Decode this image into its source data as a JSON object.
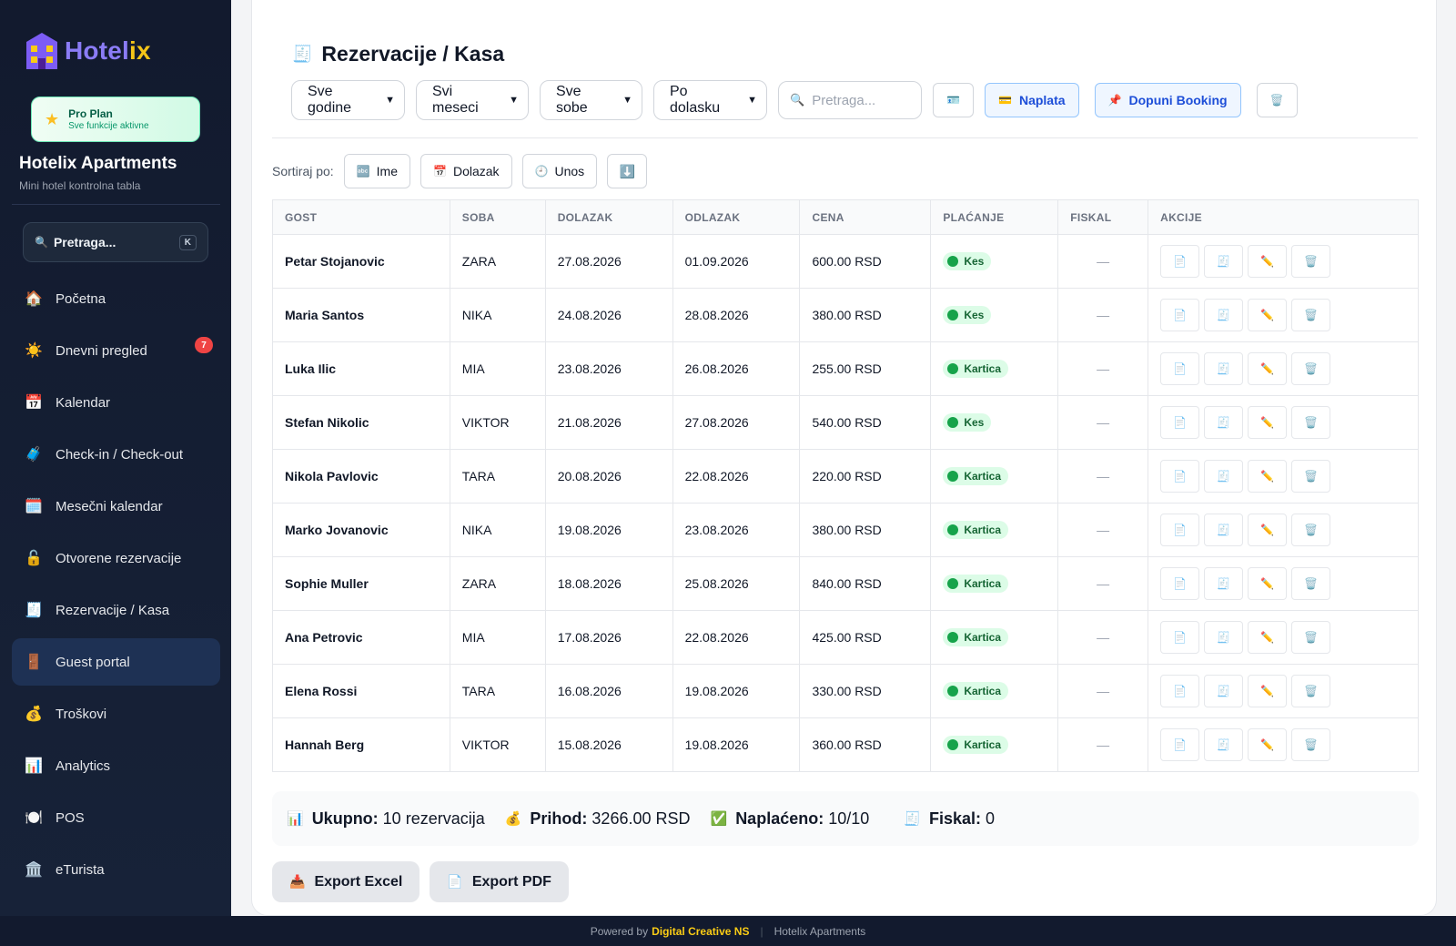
{
  "sidebar": {
    "logo": {
      "text_a": "Hotel",
      "text_b": "ix"
    },
    "plan": {
      "title": "Pro Plan",
      "subtitle": "Sve funkcije aktivne"
    },
    "hotel_name": "Hotelix Apartments",
    "hotel_sub": "Mini hotel kontrolna tabla",
    "search": {
      "label": "Pretraga...",
      "shortcut": "K"
    },
    "items": [
      {
        "label": "Početna",
        "icon": "house-icon",
        "glyph": "🏠"
      },
      {
        "label": "Dnevni pregled",
        "icon": "sun-icon",
        "glyph": "☀️",
        "badge": "7"
      },
      {
        "label": "Kalendar",
        "icon": "calendar-icon",
        "glyph": "📅"
      },
      {
        "label": "Check-in / Check-out",
        "icon": "luggage-icon",
        "glyph": "🧳"
      },
      {
        "label": "Mesečni kalendar",
        "icon": "calendar-month-icon",
        "glyph": "🗓️"
      },
      {
        "label": "Otvorene rezervacije",
        "icon": "lock-icon",
        "glyph": "🔓"
      },
      {
        "label": "Rezervacije / Kasa",
        "icon": "receipt-icon",
        "glyph": "🧾"
      },
      {
        "label": "Guest portal",
        "icon": "door-icon",
        "glyph": "🚪",
        "active": true
      },
      {
        "label": "Troškovi",
        "icon": "money-bag-icon",
        "glyph": "💰"
      },
      {
        "label": "Analytics",
        "icon": "bar-chart-icon",
        "glyph": "📊"
      },
      {
        "label": "POS",
        "icon": "plate-icon",
        "glyph": "🍽️"
      },
      {
        "label": "eTurista",
        "icon": "building-icon",
        "glyph": "🏛️"
      }
    ]
  },
  "main": {
    "title": "Rezervacije / Kasa",
    "title_icon": "🧾",
    "filters": {
      "year": "Sve godine",
      "month": "Svi meseci",
      "room": "Sve sobe",
      "order": "Po dolasku",
      "search_placeholder": "Pretraga..."
    },
    "buttons": {
      "naplata": "Naplata",
      "dopuni": "Dopuni Booking"
    },
    "sort": {
      "label": "Sortiraj po:",
      "name": "Ime",
      "arrival": "Dolazak",
      "entry": "Unos"
    },
    "columns": [
      "GOST",
      "SOBA",
      "DOLAZAK",
      "ODLAZAK",
      "CENA",
      "PLAĆANJE",
      "FISKAL",
      "AKCIJE"
    ],
    "rows": [
      {
        "guest": "Petar Stojanovic",
        "room": "ZARA",
        "arrival": "27.08.2026",
        "departure": "01.09.2026",
        "price": "600.00 RSD",
        "payment": "Kes",
        "fiscal": "—"
      },
      {
        "guest": "Maria Santos",
        "room": "NIKA",
        "arrival": "24.08.2026",
        "departure": "28.08.2026",
        "price": "380.00 RSD",
        "payment": "Kes",
        "fiscal": "—"
      },
      {
        "guest": "Luka Ilic",
        "room": "MIA",
        "arrival": "23.08.2026",
        "departure": "26.08.2026",
        "price": "255.00 RSD",
        "payment": "Kartica",
        "fiscal": "—"
      },
      {
        "guest": "Stefan Nikolic",
        "room": "VIKTOR",
        "arrival": "21.08.2026",
        "departure": "27.08.2026",
        "price": "540.00 RSD",
        "payment": "Kes",
        "fiscal": "—"
      },
      {
        "guest": "Nikola Pavlovic",
        "room": "TARA",
        "arrival": "20.08.2026",
        "departure": "22.08.2026",
        "price": "220.00 RSD",
        "payment": "Kartica",
        "fiscal": "—"
      },
      {
        "guest": "Marko Jovanovic",
        "room": "NIKA",
        "arrival": "19.08.2026",
        "departure": "23.08.2026",
        "price": "380.00 RSD",
        "payment": "Kartica",
        "fiscal": "—"
      },
      {
        "guest": "Sophie Muller",
        "room": "ZARA",
        "arrival": "18.08.2026",
        "departure": "25.08.2026",
        "price": "840.00 RSD",
        "payment": "Kartica",
        "fiscal": "—"
      },
      {
        "guest": "Ana Petrovic",
        "room": "MIA",
        "arrival": "17.08.2026",
        "departure": "22.08.2026",
        "price": "425.00 RSD",
        "payment": "Kartica",
        "fiscal": "—"
      },
      {
        "guest": "Elena Rossi",
        "room": "TARA",
        "arrival": "16.08.2026",
        "departure": "19.08.2026",
        "price": "330.00 RSD",
        "payment": "Kartica",
        "fiscal": "—"
      },
      {
        "guest": "Hannah Berg",
        "room": "VIKTOR",
        "arrival": "15.08.2026",
        "departure": "19.08.2026",
        "price": "360.00 RSD",
        "payment": "Kartica",
        "fiscal": "—"
      }
    ],
    "summary": {
      "total_label": "Ukupno:",
      "total_value": "10 rezervacija",
      "income_label": "Prihod:",
      "income_value": "3266.00 RSD",
      "paid_label": "Naplaćeno:",
      "paid_value": "10/10",
      "fiscal_label": "Fiskal:",
      "fiscal_value": "0"
    },
    "exports": {
      "excel": "Export Excel",
      "pdf": "Export PDF"
    }
  },
  "footer": {
    "powered": "Powered by",
    "brand": "Digital Creative NS",
    "app": "Hotelix Apartments"
  },
  "colors": {
    "accent": "#8b7cf6",
    "brand_yellow": "#f5c518",
    "sidebar_bg": "#121a2e",
    "paid_green": "#16a34a"
  }
}
